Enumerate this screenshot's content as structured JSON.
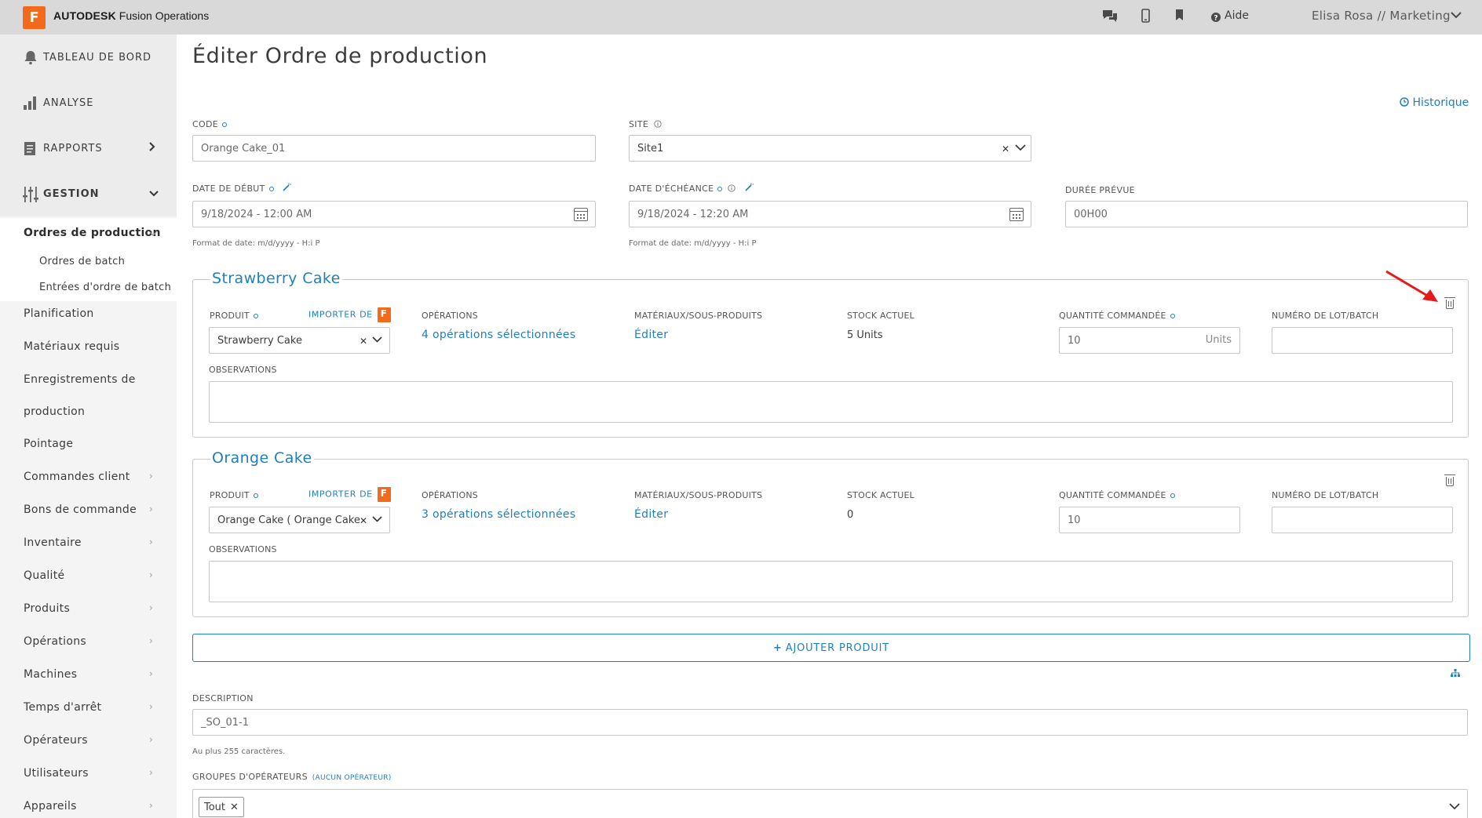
{
  "header": {
    "logo_letter": "F",
    "brand_bold": "AUTODESK",
    "brand_rest": " Fusion Operations",
    "icons": [
      "chat-icon",
      "mobile-icon",
      "bookmark-icon",
      "help-icon"
    ],
    "aide_label": "Aide",
    "user_label": "Elisa Rosa // Marketing"
  },
  "sidebar": {
    "dashboard": "TABLEAU DE BORD",
    "analyse": "ANALYSE",
    "rapports": "RAPPORTS",
    "gestion": "GESTION",
    "active_item": "Ordres de production",
    "sub_items": [
      "Ordres de batch",
      "Entrées d'ordre de batch"
    ],
    "items": [
      "Planification",
      "Matériaux requis",
      "Enregistrements de",
      "production",
      "Pointage",
      "Commandes client",
      "Bons de commande",
      "Inventaire",
      "Qualité",
      "Produits",
      "Opérations",
      "Machines",
      "Temps d'arrêt",
      "Opérateurs",
      "Utilisateurs",
      "Appareils"
    ]
  },
  "main": {
    "title": "Éditer Ordre de production",
    "historique": "Historique",
    "code_label": "CODE",
    "code_value": "Orange Cake_01",
    "site_label": "SITE",
    "site_value": "Site1",
    "start_label": "DATE DE DÉBUT",
    "start_value": "9/18/2024 - 12:00 AM",
    "due_label": "DATE D'ÉCHÉANCE",
    "due_value": "9/18/2024 - 12:20 AM",
    "duration_label": "DURÉE PRÉVUE",
    "duration_value": "00H00",
    "date_hint": "Format de date: m/d/yyyy - H:i P",
    "products": [
      {
        "title": "Strawberry Cake",
        "produit_label": "PRODUIT",
        "importer": "IMPORTER DE",
        "product_value": "Strawberry Cake",
        "ops_label": "OPÉRATIONS",
        "ops_link": "4 opérations sélectionnées",
        "mat_label": "MATÉRIAUX/SOUS-PRODUITS",
        "mat_link": "Éditer",
        "stock_label": "STOCK ACTUEL",
        "stock_value": "5 Units",
        "qty_label": "QUANTITÉ COMMANDÉE",
        "qty_value": "10",
        "qty_unit": "Units",
        "lot_label": "NUMÉRO DE LOT/BATCH",
        "obs_label": "OBSERVATIONS"
      },
      {
        "title": "Orange Cake",
        "produit_label": "PRODUIT",
        "importer": "IMPORTER DE",
        "product_value": "Orange Cake ( Orange Cake",
        "ops_label": "OPÉRATIONS",
        "ops_link": "3 opérations sélectionnées",
        "mat_label": "MATÉRIAUX/SOUS-PRODUITS",
        "mat_link": "Éditer",
        "stock_label": "STOCK ACTUEL",
        "stock_value": "0",
        "qty_label": "QUANTITÉ COMMANDÉE",
        "qty_value": "10",
        "qty_unit": "",
        "lot_label": "NUMÉRO DE LOT/BATCH",
        "obs_label": "OBSERVATIONS"
      }
    ],
    "add_product": "AJOUTER PRODUIT",
    "description_label": "DESCRIPTION",
    "description_value": "_SO_01-1",
    "description_hint": "Au plus 255 caractères.",
    "groups_label": "GROUPES D'OPÉRATEURS",
    "groups_sub": "(AUCUN OPÉRATEUR)",
    "groups_tag": "Tout"
  },
  "colors": {
    "accent": "#1f7fbf",
    "brand_orange": "#f26b1d",
    "annotation_arrow": "#e31b1b"
  }
}
